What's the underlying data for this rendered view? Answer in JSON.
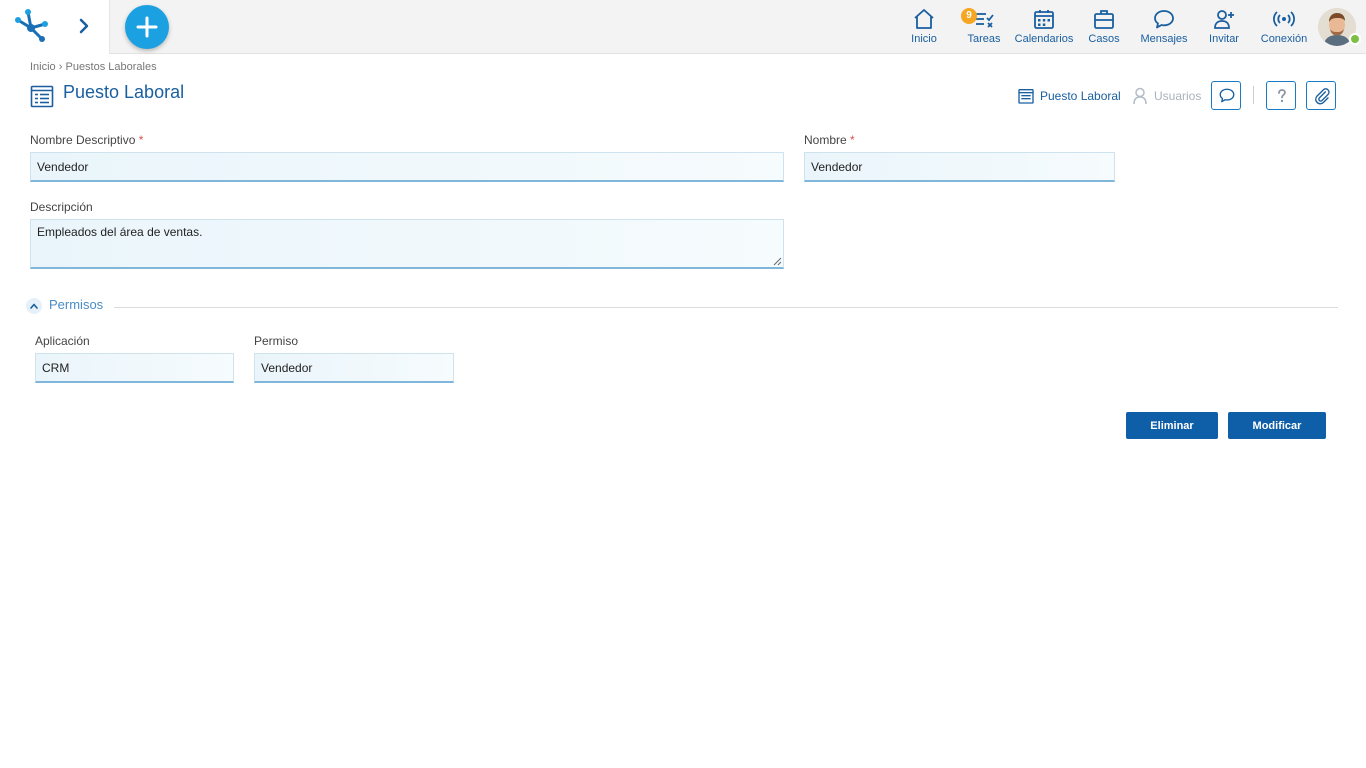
{
  "topbar": {
    "nav": [
      {
        "id": "inicio",
        "label": "Inicio",
        "icon": "home-icon"
      },
      {
        "id": "tareas",
        "label": "Tareas",
        "icon": "tasks-icon",
        "badge": "9"
      },
      {
        "id": "calendarios",
        "label": "Calendarios",
        "icon": "calendar-icon"
      },
      {
        "id": "casos",
        "label": "Casos",
        "icon": "briefcase-icon"
      },
      {
        "id": "mensajes",
        "label": "Mensajes",
        "icon": "chat-icon"
      },
      {
        "id": "invitar",
        "label": "Invitar",
        "icon": "add-user-icon"
      },
      {
        "id": "conexion",
        "label": "Conexión",
        "icon": "broadcast-icon"
      }
    ],
    "accent": "#1ba1e2",
    "badge_color": "#f5a623",
    "status_color": "#7bc043"
  },
  "breadcrumb": {
    "home": "Inicio",
    "separator": "›",
    "current": "Puestos Laborales"
  },
  "page": {
    "title": "Puesto Laboral",
    "title_color": "#1a5fa0"
  },
  "header_actions": {
    "puesto_laboral": "Puesto Laboral",
    "usuarios": "Usuarios"
  },
  "form": {
    "nombre_descriptivo": {
      "label": "Nombre Descriptivo",
      "required": "*",
      "value": "Vendedor"
    },
    "nombre": {
      "label": "Nombre",
      "required": "*",
      "value": "Vendedor"
    },
    "descripcion": {
      "label": "Descripción",
      "value": "Empleados del área de ventas."
    }
  },
  "permisos": {
    "title": "Permisos",
    "aplicacion": {
      "label": "Aplicación",
      "value": "CRM"
    },
    "permiso": {
      "label": "Permiso",
      "value": "Vendedor"
    }
  },
  "actions": {
    "delete": "Eliminar",
    "modify": "Modificar",
    "button_color": "#0f5fa8"
  }
}
